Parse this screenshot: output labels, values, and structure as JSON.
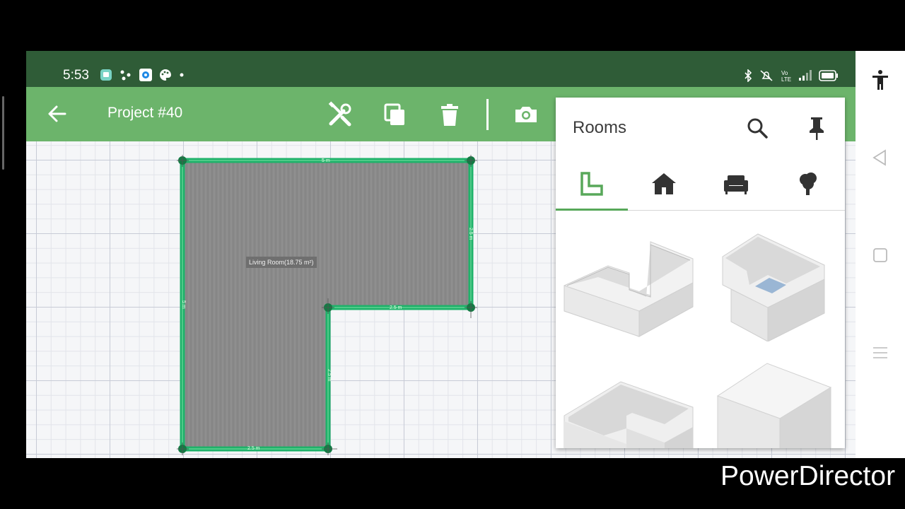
{
  "status_bar": {
    "time": "5:53",
    "left_icons": [
      "messages-icon",
      "connect-icon",
      "circle-app-icon",
      "palette-icon",
      "dot-icon"
    ],
    "right_icons": [
      "bluetooth-icon",
      "mute-icon",
      "volte-icon",
      "signal-icon",
      "battery-icon"
    ],
    "volte_text": "Vo LTE"
  },
  "toolbar": {
    "title": "Project #40",
    "icons": [
      "back-arrow-icon",
      "tools-icon",
      "copy-icon",
      "trash-icon",
      "camera-icon"
    ]
  },
  "canvas": {
    "room_label": "Living Room(18.75 m²)",
    "dimensions": {
      "top": "5 m",
      "right": "2.5 m",
      "left": "5 m",
      "inner_horizontal": "2.5 m",
      "inner_vertical": "2.5 m",
      "bottom": "2.5 m"
    }
  },
  "rooms_panel": {
    "title": "Rooms",
    "tabs": [
      {
        "name": "room-shape-icon",
        "active": true
      },
      {
        "name": "house-icon",
        "active": false
      },
      {
        "name": "sofa-icon",
        "active": false
      },
      {
        "name": "tree-icon",
        "active": false
      }
    ],
    "items": [
      "L-shaped room",
      "room with inner corner",
      "U-shaped room",
      "solid box"
    ]
  },
  "nav_bar": {
    "icons": [
      "accessibility-icon",
      "back-triangle-icon",
      "home-square-icon",
      "menu-lines-icon"
    ]
  },
  "colors": {
    "status_bar": "#2f5c37",
    "toolbar": "#6cb46b",
    "wall": "#1fb26a",
    "floor": "#8a8a8a",
    "tab_indicator": "#58a85a"
  },
  "watermark": "PowerDirector"
}
